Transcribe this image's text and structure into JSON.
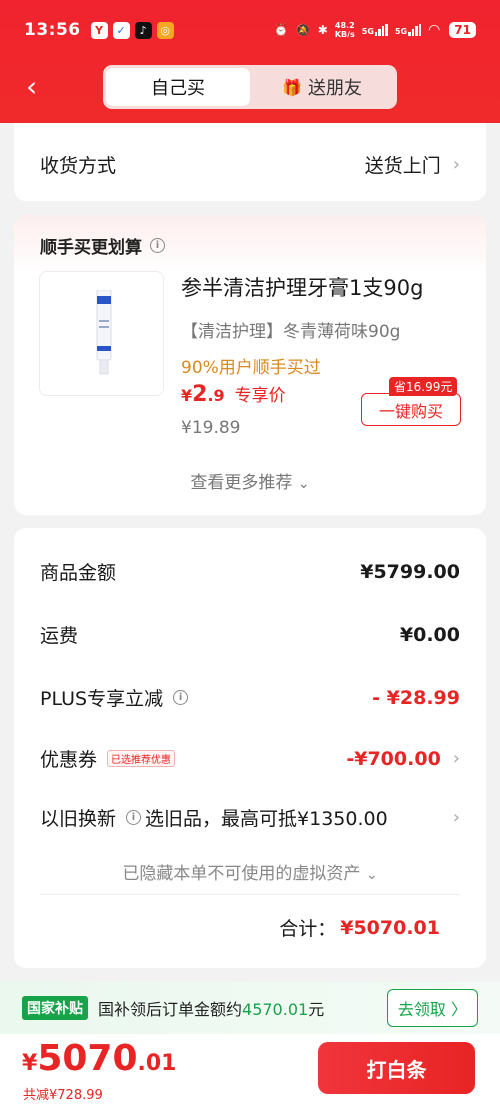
{
  "status_bar": {
    "time": "13:56",
    "net_speed_top": "48.2",
    "net_speed_bottom": "KB/s",
    "sig1": "5G",
    "sig2": "5G",
    "battery": "71"
  },
  "header": {
    "tab_self": "自己买",
    "tab_gift": "送朋友"
  },
  "delivery": {
    "label": "收货方式",
    "value": "送货上门"
  },
  "recommend": {
    "title": "顺手买更划算",
    "product_name": "参半清洁护理牙膏1支90g",
    "spec": "【清洁护理】冬青薄荷味90g",
    "buyers": "90%用户顺手买过",
    "price_symbol": "¥",
    "price_int": "2",
    "price_dec": ".9",
    "price_tag": "专享价",
    "old_price": "¥19.89",
    "save_badge": "省16.99元",
    "buy_button": "一键购买",
    "more": "查看更多推荐"
  },
  "summary": {
    "goods_label": "商品金额",
    "goods_value": "¥5799.00",
    "shipping_label": "运费",
    "shipping_value": "¥0.00",
    "plus_label": "PLUS专享立减",
    "plus_value": "- ¥28.99",
    "coupon_label": "优惠券",
    "coupon_chip": "已选推荐优惠",
    "coupon_value": "-¥700.00",
    "tradein_label": "以旧换新",
    "tradein_note": "选旧品，最高可抵¥1350.00",
    "hidden_note": "已隐藏本单不可使用的虚拟资产",
    "total_label": "合计：",
    "total_value": "¥5070.01"
  },
  "subsidy": {
    "tag": "国家补贴",
    "text_prefix": "国补领后订单金额约",
    "amount": "4570.01",
    "text_suffix": "元",
    "button": "去领取 〉"
  },
  "bottom": {
    "price_symbol": "¥",
    "price_int": "5070",
    "price_dec": ".01",
    "saved": "共减¥728.99",
    "pay_button": "打白条"
  },
  "colors": {
    "brand_red": "#e82424",
    "subsidy_green": "#17a34a",
    "buyers_orange": "#d98a1c"
  }
}
